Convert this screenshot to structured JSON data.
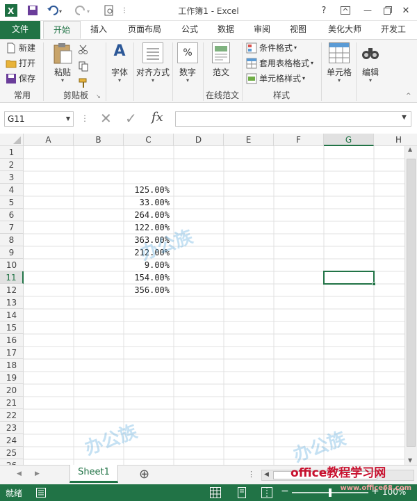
{
  "window": {
    "title": "工作簿1 - Excel",
    "help": "?",
    "minimize": "—",
    "close": "✕"
  },
  "tabs": [
    "文件",
    "开始",
    "插入",
    "页面布局",
    "公式",
    "数据",
    "审阅",
    "视图",
    "美化大师",
    "开发工"
  ],
  "ribbon": {
    "common": {
      "new": "新建",
      "open": "打开",
      "save": "保存",
      "label": "常用"
    },
    "clipboard": {
      "paste": "粘贴",
      "label": "剪贴板"
    },
    "font": {
      "label": "字体"
    },
    "align": {
      "label": "对齐方式"
    },
    "number": {
      "label": "数字",
      "icon": "%"
    },
    "template": {
      "label": "范文",
      "group": "在线范文"
    },
    "styles": {
      "cond": "条件格式",
      "table": "套用表格格式",
      "cell": "单元格样式",
      "label": "样式"
    },
    "cells": {
      "label": "单元格"
    },
    "edit": {
      "label": "编辑"
    }
  },
  "formula_bar": {
    "name_box": "G11",
    "fx": "fx",
    "value": ""
  },
  "columns": [
    "A",
    "B",
    "C",
    "D",
    "E",
    "F",
    "G",
    "H"
  ],
  "selected_column": "G",
  "selected_row": 11,
  "rows": [
    "1",
    "2",
    "3",
    "4",
    "5",
    "6",
    "7",
    "8",
    "9",
    "10",
    "11",
    "12",
    "13",
    "14",
    "15",
    "16",
    "17",
    "18",
    "19",
    "20",
    "21",
    "22",
    "23",
    "24",
    "25",
    "26"
  ],
  "cells_c": {
    "4": "125.00%",
    "5": "33.00%",
    "6": "264.00%",
    "7": "122.00%",
    "8": "363.00%",
    "9": "212.00%",
    "10": "9.00%",
    "11": "154.00%",
    "12": "356.00%"
  },
  "sheets": {
    "active": "Sheet1",
    "add": "⊕"
  },
  "status": {
    "ready": "就绪",
    "zoom": "100%"
  },
  "watermark": {
    "brand": "office教程学习网",
    "url": "www.office68.com",
    "logo": "办公族"
  },
  "colors": {
    "accent": "#217346",
    "watermark": "#5aaadc"
  }
}
